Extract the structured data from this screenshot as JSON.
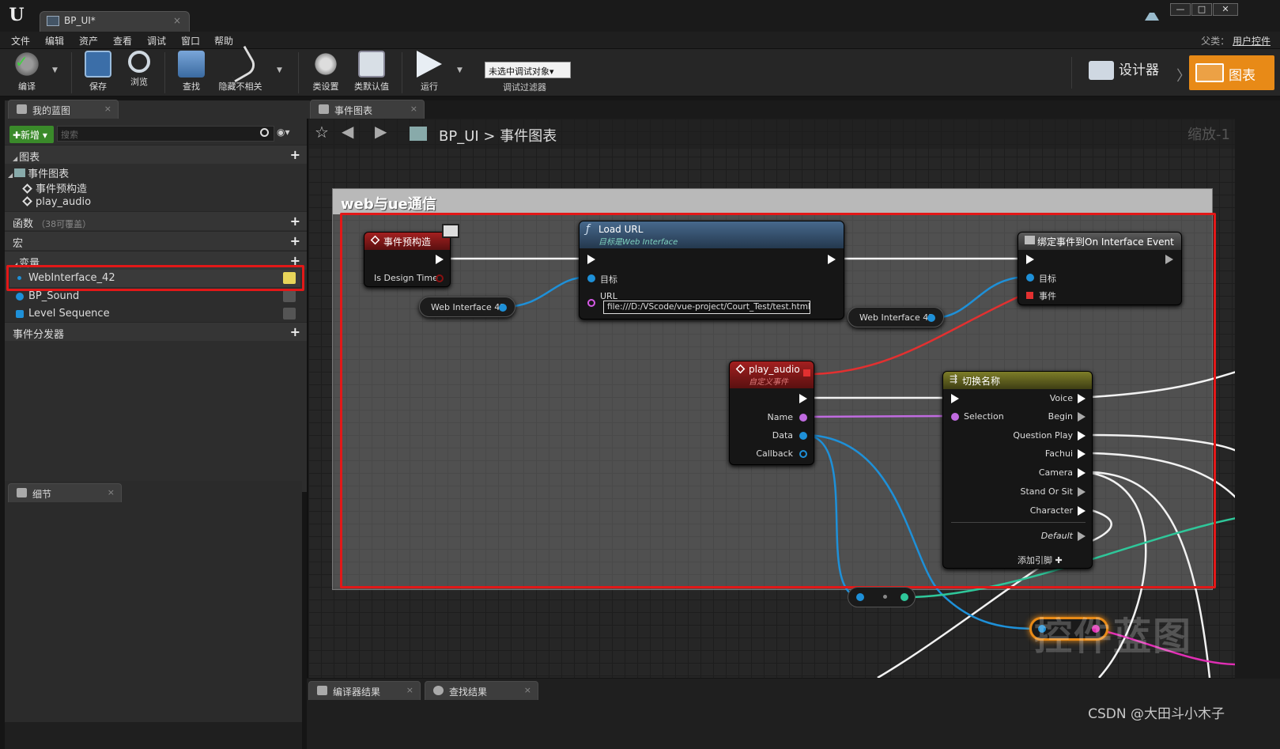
{
  "window": {
    "doc_tab": "BP_UI*",
    "parent_label": "父类：",
    "parent_value": "用户控件",
    "minimize": "—",
    "maximize": "□",
    "close": "✕"
  },
  "menu": [
    "文件",
    "编辑",
    "资产",
    "查看",
    "调试",
    "窗口",
    "帮助"
  ],
  "toolbar": {
    "compile": "编译",
    "save": "保存",
    "browse": "浏览",
    "find": "查找",
    "hide_unrelated": "隐藏不相关",
    "class_settings": "类设置",
    "class_defaults": "类默认值",
    "run": "运行",
    "debug_object": "未选中调试对象▾",
    "debug_filter": "调试过滤器",
    "designer": "设计器",
    "graph": "图表"
  },
  "my_blueprint": {
    "tab": "我的蓝图",
    "add_new": "✚新增 ▾",
    "search_placeholder": "搜索",
    "graphs_header": "图表",
    "event_graph": "事件图表",
    "event_items": [
      "事件预构造",
      "play_audio"
    ],
    "functions_header": "函数",
    "functions_note": "（38可覆盖）",
    "macros_header": "宏",
    "variables_header": "变量",
    "variables": [
      "WebInterface_42",
      "BP_Sound",
      "Level Sequence"
    ],
    "dispatchers_header": "事件分发器"
  },
  "details": {
    "tab": "细节"
  },
  "graph": {
    "tab": "事件图表",
    "breadcrumb_root": "BP_UI",
    "breadcrumb_sep": ">",
    "breadcrumb_leaf": "事件图表",
    "zoom": "缩放-1",
    "comment": "web与ue通信",
    "watermark": "控件蓝图",
    "nodes": {
      "preconstruct": {
        "title": "事件预构造",
        "pin_design": "Is Design Time"
      },
      "load_url": {
        "title": "Load URL",
        "subtitle": "目标是Web Interface",
        "pin_target": "目标",
        "pin_url": "URL",
        "url_value": "file:///D:/VScode/vue-project/Court_Test/test.html"
      },
      "web_var_1": "Web Interface 42",
      "web_var_2": "Web Interface 42",
      "bind_event": {
        "title": "绑定事件到On Interface Event",
        "pin_target": "目标",
        "pin_event": "事件"
      },
      "play_audio": {
        "title": "play_audio",
        "subtitle": "自定义事件",
        "pins": [
          "Name",
          "Data",
          "Callback"
        ]
      },
      "switch": {
        "title": "切换名称",
        "input": "Selection",
        "outputs": [
          "Voice",
          "Begin",
          "Question Play",
          "Fachui",
          "Camera",
          "Stand Or Sit",
          "Character"
        ],
        "default": "Default",
        "add_pin": "添加引脚 ✚"
      }
    }
  },
  "bottom": {
    "compiler_results": "编译器结果",
    "find_results": "查找结果"
  },
  "csdn_watermark": "CSDN @大田斗小木子",
  "colors": {
    "accent": "#e88a17",
    "highlight": "#e21818",
    "object_pin": "#1e90d8",
    "string_pin": "#d65ae6",
    "event_header": "#8a1d1d",
    "function_header": "#3a5a78"
  }
}
